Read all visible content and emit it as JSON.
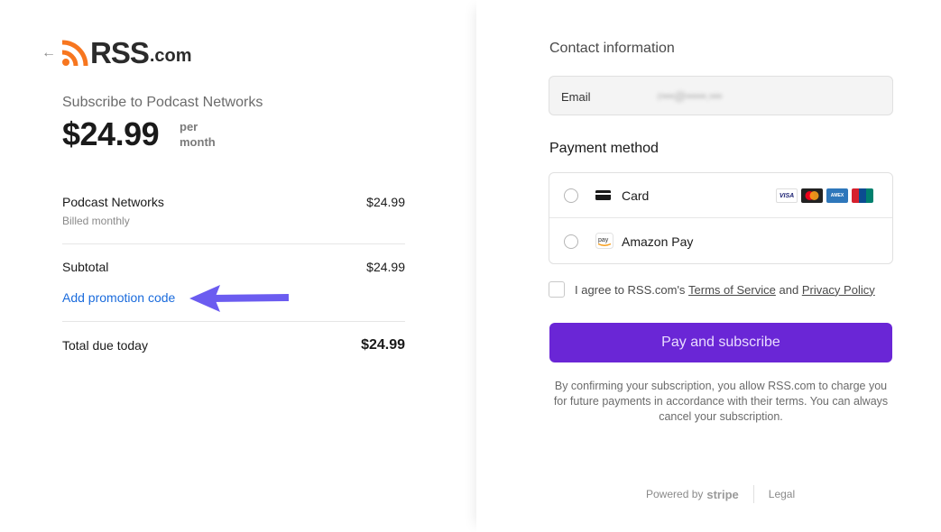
{
  "brand": {
    "logo_text": "RSS",
    "logo_suffix": ".com",
    "accent": "#f7761f"
  },
  "summary": {
    "subscribe_title": "Subscribe to Podcast Networks",
    "price": "$24.99",
    "per_line1": "per",
    "per_line2": "month",
    "item_name": "Podcast Networks",
    "item_price": "$24.99",
    "item_billing": "Billed monthly",
    "subtotal_label": "Subtotal",
    "subtotal_value": "$24.99",
    "promo_link": "Add promotion code",
    "total_label": "Total due today",
    "total_value": "$24.99"
  },
  "contact": {
    "title": "Contact information",
    "email_label": "Email",
    "email_value": "r•••@•••••.•••"
  },
  "payment": {
    "title": "Payment method",
    "options": [
      {
        "label": "Card",
        "icon": "card-icon"
      },
      {
        "label": "Amazon Pay",
        "icon": "amazon-pay-icon"
      }
    ],
    "card_brands": [
      "VISA",
      "mastercard",
      "AMEX",
      "UnionPay"
    ]
  },
  "agreement": {
    "prefix": "I agree to RSS.com's",
    "terms": "Terms of Service",
    "and": "and",
    "privacy": "Privacy Policy"
  },
  "pay_button": "Pay and subscribe",
  "pay_button_color": "#6a26d6",
  "confirm_text": "By confirming your subscription, you allow RSS.com to charge you for future payments in accordance with their terms. You can always cancel your subscription.",
  "footer": {
    "powered_by": "Powered by",
    "stripe": "stripe",
    "legal": "Legal"
  },
  "annotation_color": "#6b5cf0"
}
